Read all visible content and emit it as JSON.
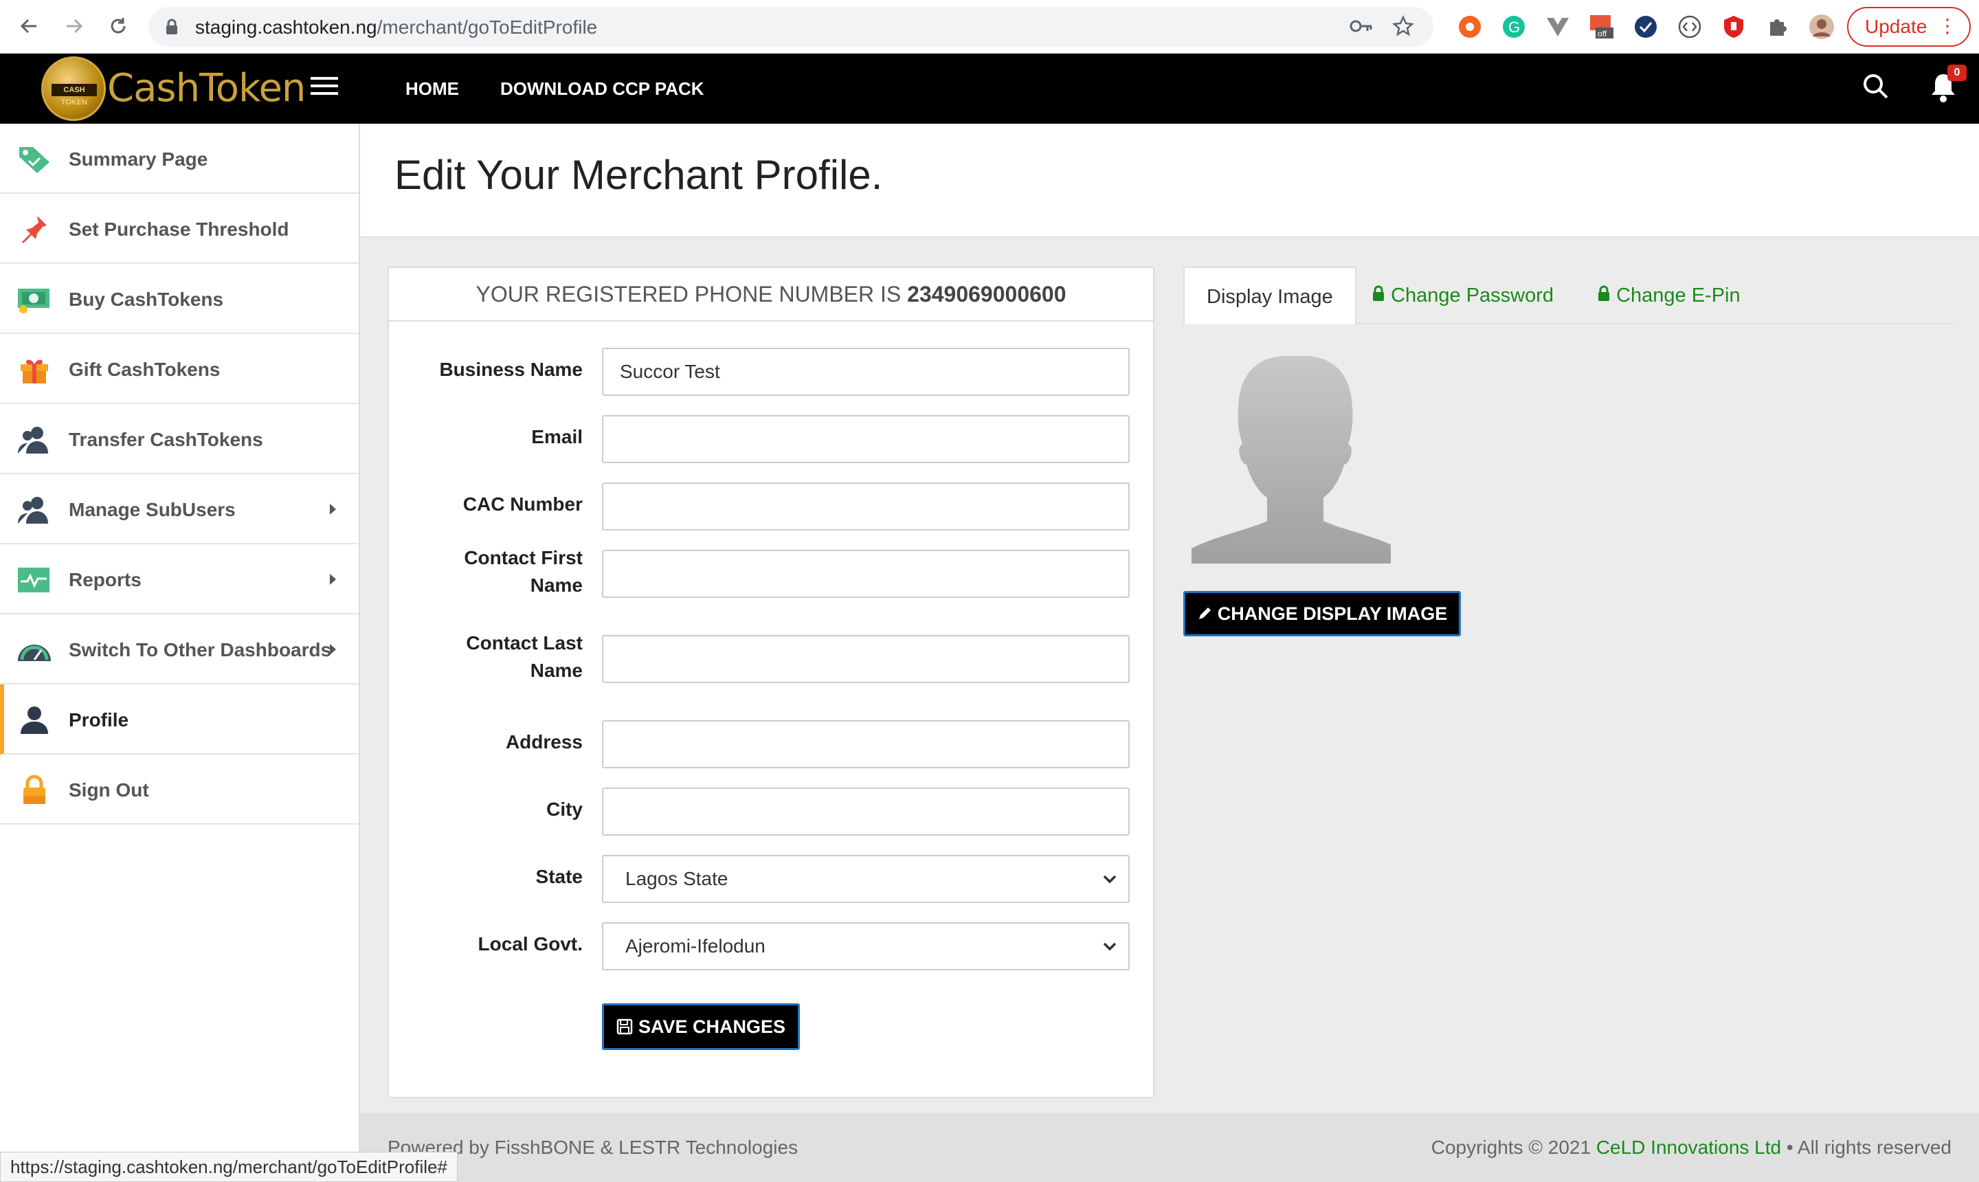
{
  "browser": {
    "url_domain": "staging.cashtoken.ng",
    "url_path": "/merchant/goToEditProfile",
    "update_label": "Update",
    "status_url": "https://staging.cashtoken.ng/merchant/goToEditProfile#"
  },
  "header": {
    "logo_coin_text": "CASH TOKEN",
    "logo_text": "CashToken",
    "nav": [
      "HOME",
      "DOWNLOAD CCP PACK"
    ],
    "notification_count": "0"
  },
  "sidebar": {
    "items": [
      {
        "label": "Summary Page",
        "icon": "tag-icon"
      },
      {
        "label": "Set Purchase Threshold",
        "icon": "pin-icon"
      },
      {
        "label": "Buy CashTokens",
        "icon": "cash-icon"
      },
      {
        "label": "Gift CashTokens",
        "icon": "gift-icon"
      },
      {
        "label": "Transfer CashTokens",
        "icon": "users-icon"
      },
      {
        "label": "Manage SubUsers",
        "icon": "users-icon",
        "has_submenu": true
      },
      {
        "label": "Reports",
        "icon": "pulse-icon",
        "has_submenu": true
      },
      {
        "label": "Switch To Other Dashboards",
        "icon": "dashboard-icon",
        "has_submenu": true
      },
      {
        "label": "Profile",
        "icon": "user-icon",
        "active": true
      },
      {
        "label": "Sign Out",
        "icon": "padlock-icon"
      }
    ]
  },
  "page": {
    "title": "Edit Your Merchant Profile."
  },
  "form": {
    "phone_prefix": "YOUR REGISTERED PHONE NUMBER IS",
    "phone_number": "2349069000600",
    "fields": {
      "business_name": {
        "label": "Business Name",
        "value": "Succor Test"
      },
      "email": {
        "label": "Email",
        "value": ""
      },
      "cac_number": {
        "label": "CAC Number",
        "value": ""
      },
      "contact_first_name": {
        "label_line1": "Contact First",
        "label_line2": "Name",
        "value": ""
      },
      "contact_last_name": {
        "label_line1": "Contact Last",
        "label_line2": "Name",
        "value": ""
      },
      "address": {
        "label": "Address",
        "value": ""
      },
      "city": {
        "label": "City",
        "value": ""
      },
      "state": {
        "label": "State",
        "value": "Lagos State"
      },
      "local_govt": {
        "label": "Local Govt.",
        "value": "Ajeromi-Ifelodun"
      }
    },
    "save_label": "SAVE CHANGES"
  },
  "profile_panel": {
    "tabs": [
      "Display Image",
      "Change Password",
      "Change E-Pin"
    ],
    "change_image_label": "CHANGE DISPLAY IMAGE"
  },
  "footer": {
    "left": "Powered by FisshBONE & LESTR Technologies",
    "right_prefix": "Copyrights © 2021",
    "company": "CeLD Innovations Ltd",
    "right_suffix": "• All rights reserved"
  },
  "colors": {
    "accent_green": "#1a8a1a",
    "active_marker": "#f5a623",
    "header_bg": "#000000",
    "brand_gold": "#c9a13d"
  }
}
